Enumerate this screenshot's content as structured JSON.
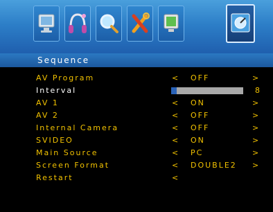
{
  "menu": {
    "icons": [
      "monitor-icon",
      "headphones-icon",
      "magnifier-icon",
      "tools-icon",
      "display-settings-icon",
      "satellite-dish-icon"
    ],
    "selected_index": 5
  },
  "section_title": "Sequence",
  "items": [
    {
      "label": "AV Program",
      "value": "OFF",
      "left_arrow": "<",
      "right_arrow": ">"
    },
    {
      "label": "Interval",
      "progress": 0.08,
      "number": "8"
    },
    {
      "label": "AV 1",
      "value": "ON",
      "left_arrow": "<",
      "right_arrow": ">"
    },
    {
      "label": "AV 2",
      "value": "OFF",
      "left_arrow": "<",
      "right_arrow": ">"
    },
    {
      "label": "Internal Camera",
      "value": "OFF",
      "left_arrow": "<",
      "right_arrow": ">"
    },
    {
      "label": "SVIDEO",
      "value": "ON",
      "left_arrow": "<",
      "right_arrow": ">"
    },
    {
      "label": "Main Source",
      "value": "PC",
      "left_arrow": "<",
      "right_arrow": ">"
    },
    {
      "label": "Screen Format",
      "value": "DOUBLE2",
      "left_arrow": "<",
      "right_arrow": ">"
    },
    {
      "label": "Restart",
      "left_arrow": "<"
    }
  ],
  "colors": {
    "text": "#f2c200",
    "selected_text": "#ffffff",
    "accent": "#2a63b8"
  }
}
